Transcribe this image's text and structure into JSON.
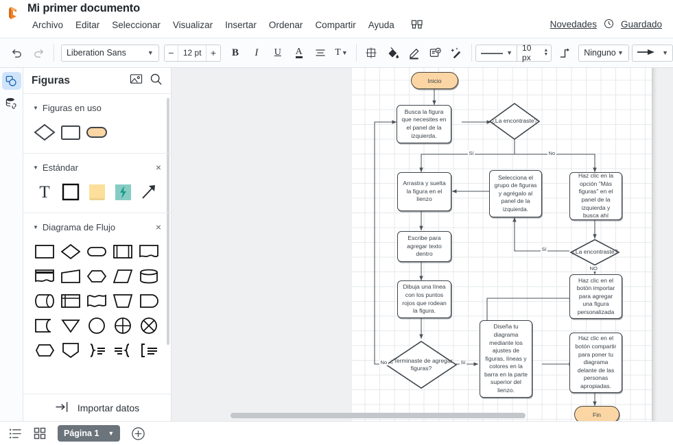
{
  "header": {
    "doc_title": "Mi primer documento",
    "logo_icon": "lucid-logo-icon",
    "menu": [
      "Archivo",
      "Editar",
      "Seleccionar",
      "Visualizar",
      "Insertar",
      "Ordenar",
      "Compartir",
      "Ayuda"
    ],
    "apps_icon": "apps-grid-icon",
    "news_label": "Novedades",
    "saved_label": "Guardado",
    "saved_icon": "clock-icon"
  },
  "toolbar": {
    "undo_icon": "undo-arrow-icon",
    "redo_icon": "redo-arrow-icon",
    "font_family": "Liberation Sans",
    "font_size": "12 pt",
    "decrease_label": "−",
    "increase_label": "+",
    "bold_label": "B",
    "italic_label": "I",
    "underline_label": "U",
    "font_color_label": "A",
    "align_icon": "align-left-icon",
    "text_options_label": "T",
    "position_icon": "position-crosshair-icon",
    "fill_icon": "paint-bucket-icon",
    "line_color_icon": "pencil-underline-icon",
    "theme_icon": "theme-card-icon",
    "magic_icon": "magic-wand-icon",
    "line_style_icon": "solid-line-icon",
    "line_width": "10 px",
    "elbow_icon": "elbow-connector-icon",
    "line_start": "Ninguno",
    "line_end_icon": "arrow-end-icon"
  },
  "rail": {
    "shapes_icon": "shapes-panel-icon",
    "data_icon": "data-linking-icon"
  },
  "panel": {
    "title": "Figuras",
    "image_icon": "image-icon",
    "search_icon": "search-icon",
    "sections": [
      {
        "title": "Figuras en uso",
        "closable": false,
        "shapes": [
          "diamond",
          "rectangle",
          "rounded-pill-orange"
        ]
      },
      {
        "title": "Estándar",
        "closable": true,
        "close_label": "×",
        "shapes": [
          "text-T",
          "square",
          "sticky-note-yellow",
          "lightning-teal",
          "arrow-diagonal"
        ]
      },
      {
        "title": "Diagrama de Flujo",
        "closable": true,
        "close_label": "×",
        "shapes": [
          "process-rectangle",
          "decision-diamond",
          "terminator-pill",
          "predefined-process",
          "document",
          "multi-document",
          "manual-input",
          "preparation-hexagon",
          "data-parallelogram",
          "database-cylinder",
          "direct-access-storage",
          "internal-storage",
          "wave-document",
          "manual-operation",
          "display",
          "stored-data",
          "merge-triangle",
          "connector-circle",
          "summing-junction",
          "or-circle",
          "delay-hexagon",
          "extract-pentagon",
          "brace-right",
          "brace-left",
          "bracket-left"
        ]
      }
    ],
    "import_label": "Importar datos",
    "import_icon": "import-arrow-icon"
  },
  "flow": {
    "nodes": [
      {
        "id": "inicio",
        "type": "terminator",
        "text": "Inicio"
      },
      {
        "id": "busca",
        "type": "process",
        "text": "Busca la figura que necesites en el panel de la izquierda."
      },
      {
        "id": "d1",
        "type": "decision",
        "text": "¿La encontraste?"
      },
      {
        "id": "mas",
        "type": "process",
        "text": "Haz clic en la opción \"Más figuras\" en el panel de la izquierda y busca ahí"
      },
      {
        "id": "arrastra",
        "type": "process",
        "text": "Arrastra y suelta la figura en el lienzo"
      },
      {
        "id": "selecciona",
        "type": "process",
        "text": "Selecciona el grupo de figuras y agrégalo al panel de la izquierda."
      },
      {
        "id": "d2",
        "type": "decision",
        "text": "¿La encontraste?"
      },
      {
        "id": "escribe",
        "type": "process",
        "text": "Escribe para agregar texto dentro"
      },
      {
        "id": "importar",
        "type": "process",
        "text": "Haz clic en el botón importar para agregar una figura personalizada"
      },
      {
        "id": "dibuja",
        "type": "process",
        "text": "Dibuja una línea con los puntos rojos que rodean la figura."
      },
      {
        "id": "d3",
        "type": "decision",
        "text": "¿Terminaste de agregar figuras?"
      },
      {
        "id": "disena",
        "type": "process",
        "text": "Diseña tu diagrama mediante los ajustes de figuras, líneas y colores en la barra en la parte superior del lienzo."
      },
      {
        "id": "compartir",
        "type": "process",
        "text": "Haz clic en el botón compartir para poner tu diagrama delante de las personas apropiadas."
      },
      {
        "id": "fin",
        "type": "terminator",
        "text": "Fin"
      }
    ],
    "edge_labels": {
      "d1_yes": "Sí",
      "d1_no": "No",
      "d2_yes": "Sí",
      "d2_no": "NO",
      "d3_yes": "Sí",
      "d3_no": "No"
    },
    "colors": {
      "terminator_fill": "#fbd6a4",
      "node_stroke": "#3e444a",
      "node_fill": "#ffffff",
      "grid": "#e6e8eb"
    }
  },
  "footer": {
    "list_icon": "list-view-icon",
    "grid_icon": "grid-view-icon",
    "page_label": "Página 1",
    "page_caret": "▼",
    "add_icon": "add-page-icon"
  }
}
